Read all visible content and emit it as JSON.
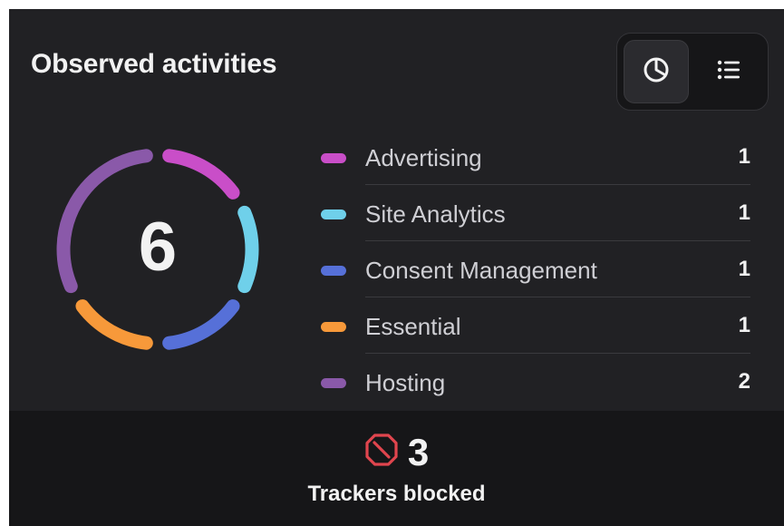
{
  "header": {
    "title": "Observed activities",
    "view_toggle": {
      "pie_icon": "pie-chart-icon",
      "list_icon": "list-icon",
      "active": "pie"
    }
  },
  "summary": {
    "total": "6"
  },
  "chart_data": {
    "type": "pie",
    "categories": [
      "Advertising",
      "Site Analytics",
      "Consent Management",
      "Essential",
      "Hosting"
    ],
    "values": [
      1,
      1,
      1,
      1,
      2
    ],
    "colors": [
      "#c94ec8",
      "#6fd0ea",
      "#5670d8",
      "#f7993a",
      "#8a59a9"
    ],
    "center_label": "6"
  },
  "legend": [
    {
      "label": "Advertising",
      "count": "1",
      "color": "#c94ec8"
    },
    {
      "label": "Site Analytics",
      "count": "1",
      "color": "#6fd0ea"
    },
    {
      "label": "Consent Management",
      "count": "1",
      "color": "#5670d8"
    },
    {
      "label": "Essential",
      "count": "1",
      "color": "#f7993a"
    },
    {
      "label": "Hosting",
      "count": "2",
      "color": "#8a59a9"
    }
  ],
  "footer": {
    "icon": "block-icon",
    "icon_color": "#e0454e",
    "blocked_count": "3",
    "blocked_label": "Trackers blocked"
  },
  "colors": {
    "panel_bg": "#212124",
    "footer_bg": "#161618",
    "text_primary": "#f2f2f2",
    "text_secondary": "#cfcfd4"
  }
}
